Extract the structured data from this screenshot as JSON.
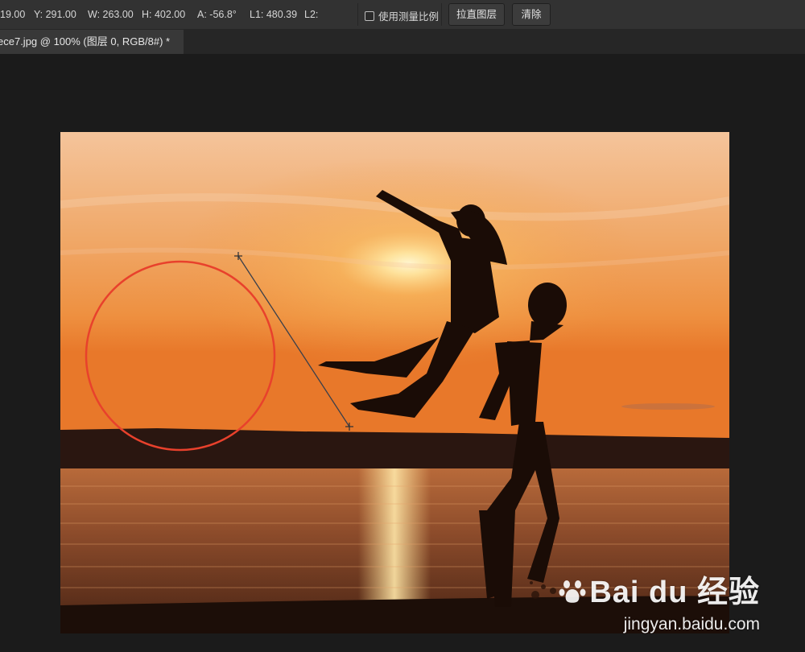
{
  "options_bar": {
    "x_readout": "19.00",
    "y_readout": "Y: 291.00",
    "w_readout": "W: 263.00",
    "h_readout": "H: 402.00",
    "angle_readout": "A: -56.8°",
    "l1_readout": "L1: 480.39",
    "l2_readout": "L2:",
    "use_scale_label": "使用测量比例",
    "use_scale_checked": false,
    "straighten_label": "拉直图层",
    "clear_label": "清除"
  },
  "document_tab": {
    "title": "ece7.jpg @ 100% (图层 0, RGB/8#) *"
  },
  "watermark": {
    "logo_text": "Bai du 经验",
    "url_text": "jingyan.baidu.com"
  },
  "colors": {
    "annotation_circle": "#e8412c",
    "measure_line": "#3a3f4a",
    "sky_top": "#f2b98a",
    "sun_glow": "#fff3c4"
  },
  "icons": {
    "measure_endpoint": "crosshair-icon",
    "watermark_paw": "paw-icon"
  }
}
